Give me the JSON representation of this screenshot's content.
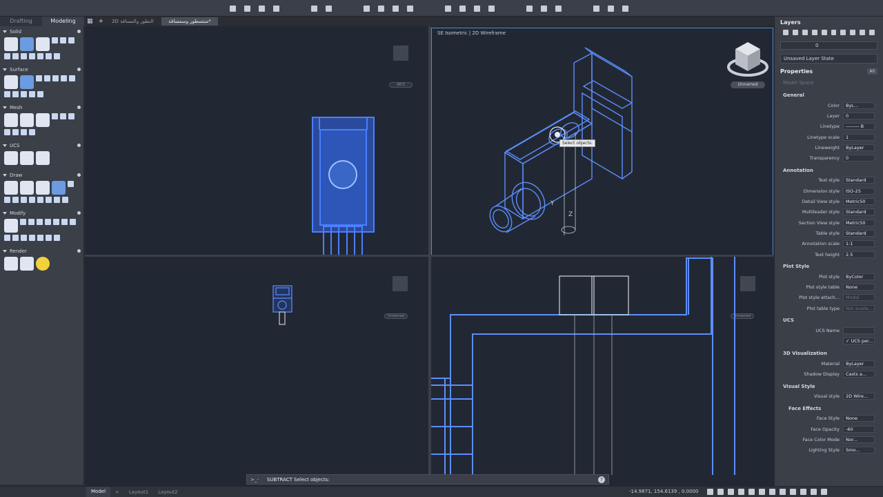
{
  "workspace_tabs": [
    "Drafting",
    "Modeling"
  ],
  "doc_tabs": [
    "2D التطور والمسافة",
    "منتسطور وسمسافة*"
  ],
  "palette_sections": [
    "Solid",
    "Surface",
    "Mesh",
    "UCS",
    "Draw",
    "Modify",
    "Render"
  ],
  "viewport_tr_label": "SE Isometric | 2D Wireframe",
  "viewcube_wcs": "Unnamed",
  "ghost_wcs_label": "Unnamed",
  "ghost_wcs_label_tl": "WCS",
  "tooltip": "Select objects:",
  "command": {
    "prefix": ">_-",
    "text": "SUBTRACT Select objects:",
    "help": "?"
  },
  "status": {
    "coords": "-14.9871, 154.6139 , 0.0000",
    "layouts": [
      "Model",
      "Layout1",
      "Layout2"
    ],
    "add": "+"
  },
  "layers": {
    "title": "Layers",
    "current_layer": "0",
    "layer_state": "Unsaved Layer State"
  },
  "properties": {
    "title": "Properties",
    "filter": "All",
    "space": "Model Space",
    "groups": [
      {
        "name": "General",
        "rows": [
          {
            "label": "Color",
            "value": "ByL..."
          },
          {
            "label": "Layer",
            "value": "0"
          },
          {
            "label": "Linetype",
            "value": "——— B"
          },
          {
            "label": "Linetype scale",
            "value": "1"
          },
          {
            "label": "Lineweight",
            "value": "ByLayer"
          },
          {
            "label": "Transparency",
            "value": "0"
          }
        ]
      },
      {
        "name": "Annotation",
        "rows": [
          {
            "label": "Text style",
            "value": "Standard"
          },
          {
            "label": "Dimension style",
            "value": "ISO-25"
          },
          {
            "label": "Detail View style",
            "value": "Metric50"
          },
          {
            "label": "Multileader style",
            "value": "Standard"
          },
          {
            "label": "Section View style",
            "value": "Metric50"
          },
          {
            "label": "Table style",
            "value": "Standard"
          },
          {
            "label": "Annotation scale",
            "value": "1:1"
          },
          {
            "label": "Text height",
            "value": "2.5"
          }
        ]
      },
      {
        "name": "Plot Style",
        "rows": [
          {
            "label": "Plot style",
            "value": "ByColor"
          },
          {
            "label": "Plot style table",
            "value": "None"
          },
          {
            "label": "Plot style attach...",
            "value": "Model"
          },
          {
            "label": "Plot table type",
            "value": "Not availa..."
          }
        ]
      },
      {
        "name": "UCS",
        "rows": [
          {
            "label": "UCS Name",
            "value": ""
          },
          {
            "label": "",
            "value": "✓ UCS per..."
          }
        ]
      },
      {
        "name": "3D Visualization",
        "rows": [
          {
            "label": "Material",
            "value": "ByLayer"
          },
          {
            "label": "Shadow Display",
            "value": "Casts a..."
          }
        ]
      },
      {
        "name": "Visual Style",
        "rows": [
          {
            "label": "Visual style",
            "value": "2D Wire..."
          }
        ]
      },
      {
        "name": "Face Effects",
        "rows": [
          {
            "label": "Face Style",
            "value": "None"
          },
          {
            "label": "Face Opacity",
            "value": "-60"
          },
          {
            "label": "Face Color Mode",
            "value": "Nor..."
          },
          {
            "label": "Lighting Style",
            "value": "Smo..."
          }
        ]
      }
    ]
  }
}
